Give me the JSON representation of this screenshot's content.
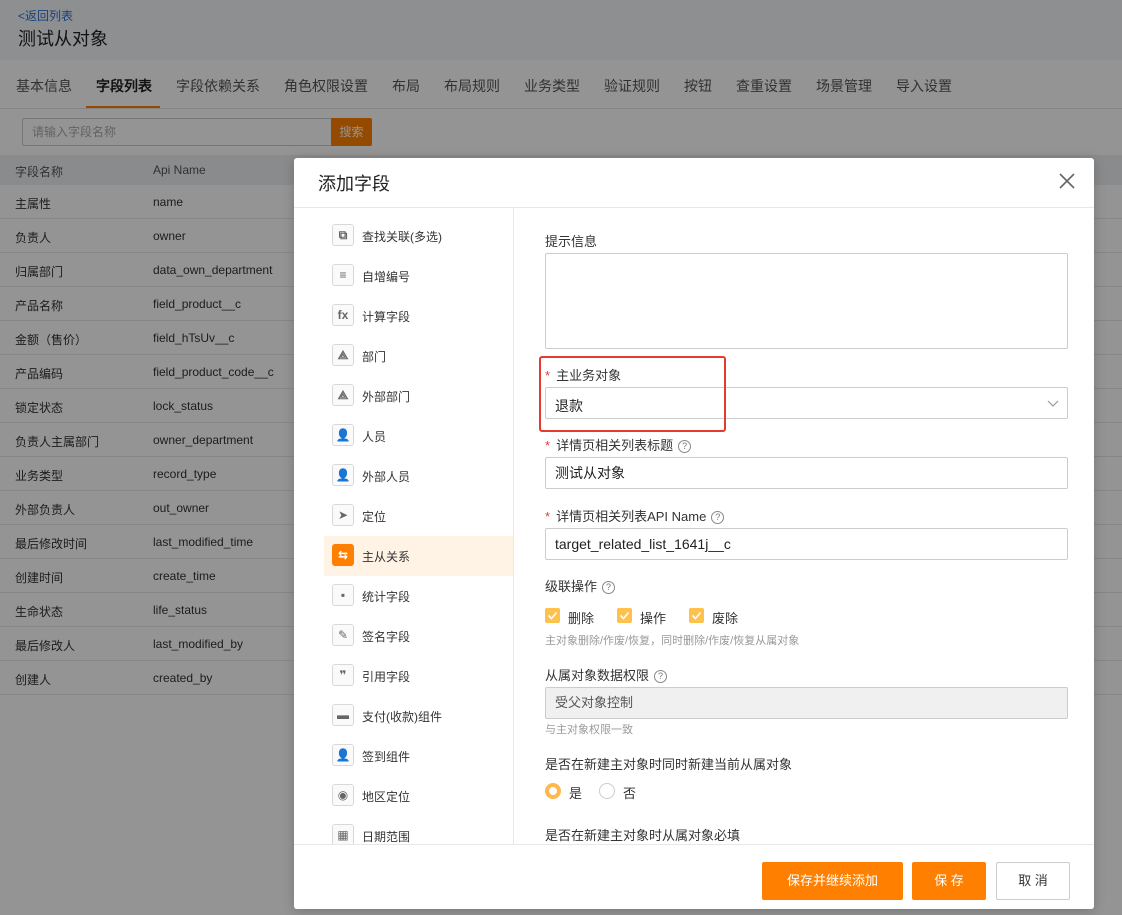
{
  "page": {
    "back_link": "<返回列表",
    "title": "测试从对象",
    "tabs": [
      "基本信息",
      "字段列表",
      "字段依赖关系",
      "角色权限设置",
      "布局",
      "布局规则",
      "业务类型",
      "验证规则",
      "按钮",
      "查重设置",
      "场景管理",
      "导入设置"
    ],
    "active_tab": "字段列表",
    "search_placeholder": "请输入字段名称",
    "search_button": "搜索",
    "table_headers": [
      "字段名称",
      "Api Name"
    ],
    "rows": [
      [
        "主属性",
        "name"
      ],
      [
        "负责人",
        "owner"
      ],
      [
        "归属部门",
        "data_own_department"
      ],
      [
        "产品名称",
        "field_product__c"
      ],
      [
        "金额（售价）",
        "field_hTsUv__c"
      ],
      [
        "产品编码",
        "field_product_code__c"
      ],
      [
        "锁定状态",
        "lock_status"
      ],
      [
        "负责人主属部门",
        "owner_department"
      ],
      [
        "业务类型",
        "record_type"
      ],
      [
        "外部负责人",
        "out_owner"
      ],
      [
        "最后修改时间",
        "last_modified_time"
      ],
      [
        "创建时间",
        "create_time"
      ],
      [
        "生命状态",
        "life_status"
      ],
      [
        "最后修改人",
        "last_modified_by"
      ],
      [
        "创建人",
        "created_by"
      ]
    ]
  },
  "modal": {
    "title": "添加字段",
    "menu": [
      {
        "label": "查找关联(多选)",
        "icon": "lookup-multi-icon",
        "glyph": "⧉"
      },
      {
        "label": "自增编号",
        "icon": "auto-number-icon",
        "glyph": "≡"
      },
      {
        "label": "计算字段",
        "icon": "formula-icon",
        "glyph": "fx"
      },
      {
        "label": "部门",
        "icon": "department-icon",
        "glyph": "⟁"
      },
      {
        "label": "外部部门",
        "icon": "external-department-icon",
        "glyph": "⟁"
      },
      {
        "label": "人员",
        "icon": "person-icon",
        "glyph": "👤"
      },
      {
        "label": "外部人员",
        "icon": "external-person-icon",
        "glyph": "👤"
      },
      {
        "label": "定位",
        "icon": "location-arrow-icon",
        "glyph": "➤"
      },
      {
        "label": "主从关系",
        "icon": "master-detail-icon",
        "glyph": "⇆"
      },
      {
        "label": "统计字段",
        "icon": "statistics-icon",
        "glyph": "▪"
      },
      {
        "label": "签名字段",
        "icon": "signature-icon",
        "glyph": "✎"
      },
      {
        "label": "引用字段",
        "icon": "quote-icon",
        "glyph": "❞"
      },
      {
        "label": "支付(收款)组件",
        "icon": "payment-icon",
        "glyph": "▬"
      },
      {
        "label": "签到组件",
        "icon": "checkin-icon",
        "glyph": "👤"
      },
      {
        "label": "地区定位",
        "icon": "map-pin-icon",
        "glyph": "◉"
      },
      {
        "label": "日期范围",
        "icon": "calendar-icon",
        "glyph": "▦"
      }
    ],
    "active_menu": "主从关系",
    "form": {
      "tip_label": "提示信息",
      "tip_value": "",
      "master_label": "主业务对象",
      "master_value": "退款",
      "related_title_label": "详情页相关列表标题",
      "related_title_value": "测试从对象",
      "related_api_label": "详情页相关列表API Name",
      "related_api_value": "target_related_list_1641j__c",
      "cascade_label": "级联操作",
      "cascade_options": [
        "删除",
        "操作",
        "废除"
      ],
      "cascade_hint": "主对象删除/作废/恢复，同时删除/作废/恢复从属对象",
      "permission_label": "从属对象数据权限",
      "permission_value": "受父对象控制",
      "permission_hint": "与主对象权限一致",
      "create_together_label": "是否在新建主对象时同时新建当前从属对象",
      "yes": "是",
      "no": "否",
      "required_label": "是否在新建主对象时从属对象必填"
    },
    "buttons": {
      "save_continue": "保存并继续添加",
      "save": "保 存",
      "cancel": "取 消"
    }
  },
  "colors": {
    "accent": "#ff8000",
    "highlight": "#e43b2c",
    "checkbox": "#ffc14d"
  }
}
